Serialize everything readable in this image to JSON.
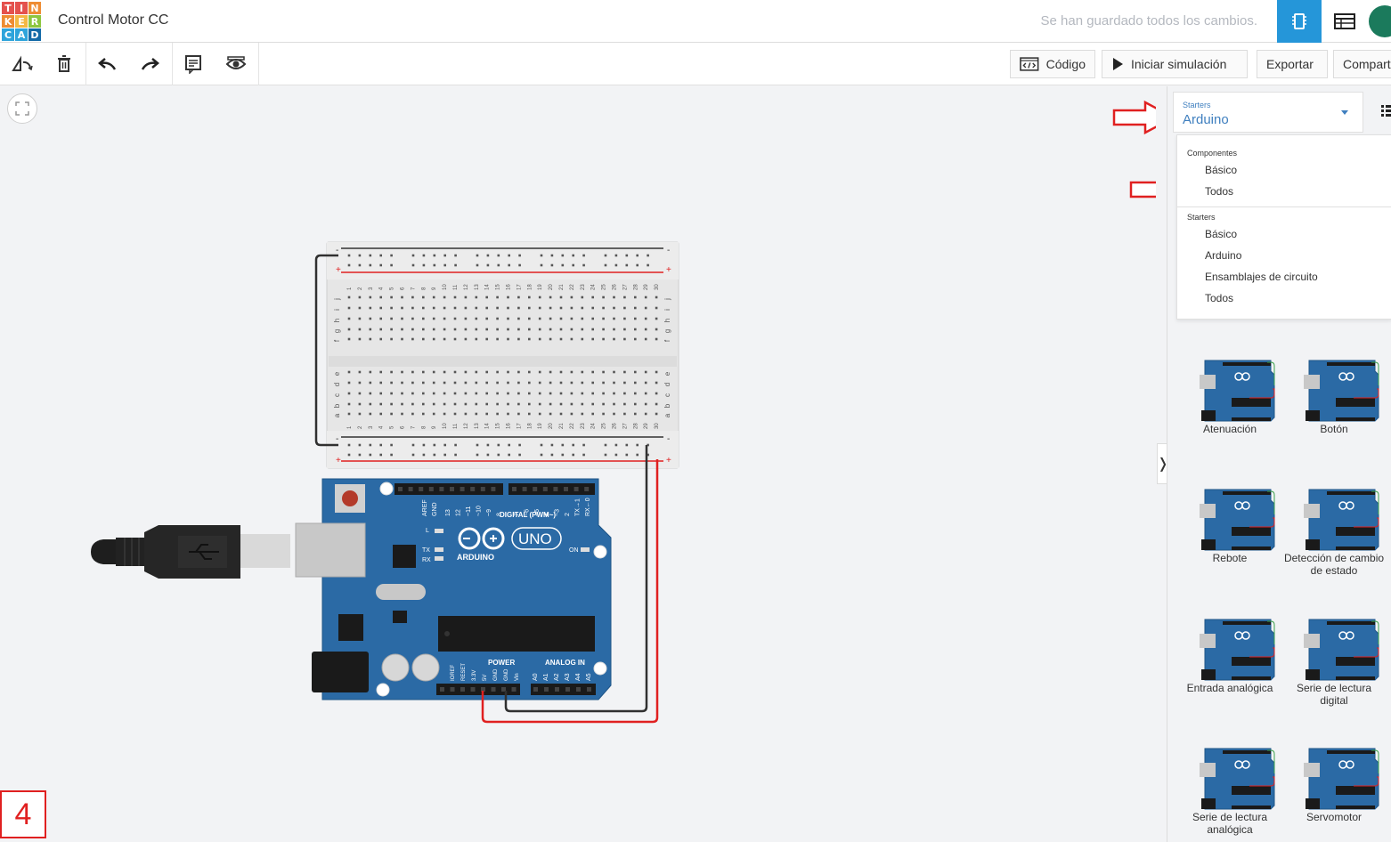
{
  "app": {
    "logo": {
      "letters": [
        "T",
        "I",
        "N",
        "K",
        "E",
        "R",
        "C",
        "A",
        "D"
      ],
      "colors": [
        "#e4514d",
        "#e4514d",
        "#ee8c33",
        "#ee8c33",
        "#f3b844",
        "#8dc63f",
        "#2fa4db",
        "#2fa4db",
        "#136aa8"
      ]
    },
    "title": "Control Motor CC",
    "save_status": "Se han guardado todos los cambios."
  },
  "toolbar": {
    "code_label": "Código",
    "sim_label": "Iniciar simulación",
    "export_label": "Exportar",
    "share_label": "Compartir"
  },
  "panel": {
    "select": {
      "label": "Starters",
      "value": "Arduino"
    },
    "dropdown": {
      "sections": [
        {
          "heading": "Componentes",
          "items": [
            "Básico",
            "Todos"
          ]
        },
        {
          "heading": "Starters",
          "items": [
            "Básico",
            "Arduino",
            "Ensamblajes de circuito",
            "Todos"
          ]
        }
      ]
    },
    "cards": [
      {
        "label": "Atenuación"
      },
      {
        "label": "Botón"
      },
      {
        "label": "Rebote"
      },
      {
        "label": "Detección de cambio de estado"
      },
      {
        "label": "Entrada analógica"
      },
      {
        "label": "Serie de lectura digital"
      },
      {
        "label": "Serie de lectura analógica"
      },
      {
        "label": "Servomotor"
      }
    ]
  },
  "canvas": {
    "arduino": {
      "brand": "ARDUINO",
      "model": "UNO",
      "digital_label": "DIGITAL (PWM~)",
      "power_label": "POWER",
      "analog_label": "ANALOG IN",
      "on_label": "ON",
      "l_label": "L",
      "tx_label": "TX",
      "rx_label": "RX",
      "aref": "AREF",
      "gnd": "GND",
      "power_pins": [
        "IOREF",
        "RESET",
        "3.3V",
        "5V",
        "GND",
        "GND",
        "Vin"
      ],
      "analog_pins": [
        "A0",
        "A1",
        "A2",
        "A3",
        "A4",
        "A5"
      ],
      "digital_pins": [
        "13",
        "12",
        "~11",
        "~10",
        "~9",
        "8",
        "7",
        "~6",
        "~5",
        "4",
        "~3",
        "2",
        "TX→1",
        "RX←0"
      ]
    },
    "breadboard": {
      "columns": [
        "1",
        "2",
        "3",
        "4",
        "5",
        "6",
        "7",
        "8",
        "9",
        "10",
        "11",
        "12",
        "13",
        "14",
        "15",
        "16",
        "17",
        "18",
        "19",
        "20",
        "21",
        "22",
        "23",
        "24",
        "25",
        "26",
        "27",
        "28",
        "29",
        "30"
      ],
      "rows_top": [
        "j",
        "i",
        "h",
        "g",
        "f"
      ],
      "rows_bottom": [
        "e",
        "d",
        "c",
        "b",
        "a"
      ],
      "rail_plus": "+",
      "rail_minus": "-"
    },
    "colors": {
      "wire_red": "#e02020",
      "wire_black": "#303030",
      "board_blue": "#2b6aa5"
    }
  },
  "step_number": "4"
}
